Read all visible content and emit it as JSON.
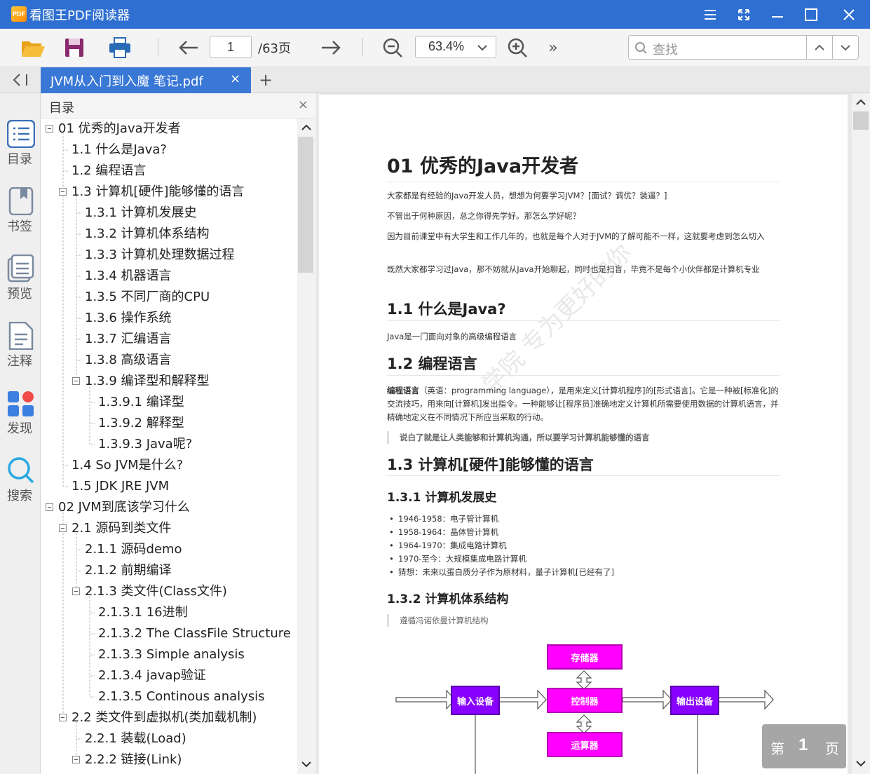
{
  "app": {
    "title": "看图王PDF阅读器",
    "logo_text": "PDF"
  },
  "toolbar": {
    "page_current": "1",
    "page_total": "/63页",
    "zoom": "63.4%",
    "more": "»",
    "search_placeholder": "查找"
  },
  "tabs": {
    "active_label": "JVM从入门到入魔 笔记.pdf",
    "close": "×",
    "add": "+"
  },
  "rail": [
    {
      "label": "目录",
      "icon": "toc-icon"
    },
    {
      "label": "书签",
      "icon": "bookmark-icon"
    },
    {
      "label": "预览",
      "icon": "preview-icon"
    },
    {
      "label": "注释",
      "icon": "annotation-icon"
    },
    {
      "label": "发现",
      "icon": "discover-icon"
    },
    {
      "label": "搜索",
      "icon": "search-icon"
    }
  ],
  "toc": {
    "title": "目录",
    "close": "×",
    "items": [
      {
        "text": "01 优秀的Java开发者",
        "level": 0,
        "expandable": true
      },
      {
        "text": "1.1 什么是Java?",
        "level": 1,
        "expandable": false
      },
      {
        "text": "1.2 编程语言",
        "level": 1,
        "expandable": false
      },
      {
        "text": "1.3 计算机[硬件]能够懂的语言",
        "level": 1,
        "expandable": true
      },
      {
        "text": "1.3.1 计算机发展史",
        "level": 2,
        "expandable": false
      },
      {
        "text": "1.3.2 计算机体系结构",
        "level": 2,
        "expandable": false
      },
      {
        "text": "1.3.3 计算机处理数据过程",
        "level": 2,
        "expandable": false
      },
      {
        "text": "1.3.4 机器语言",
        "level": 2,
        "expandable": false
      },
      {
        "text": "1.3.5 不同厂商的CPU",
        "level": 2,
        "expandable": false
      },
      {
        "text": "1.3.6 操作系统",
        "level": 2,
        "expandable": false
      },
      {
        "text": "1.3.7 汇编语言",
        "level": 2,
        "expandable": false
      },
      {
        "text": "1.3.8 高级语言",
        "level": 2,
        "expandable": false
      },
      {
        "text": "1.3.9 编译型和解释型",
        "level": 2,
        "expandable": true
      },
      {
        "text": "1.3.9.1 编译型",
        "level": 3,
        "expandable": false
      },
      {
        "text": "1.3.9.2 解释型",
        "level": 3,
        "expandable": false
      },
      {
        "text": "1.3.9.3 Java呢?",
        "level": 3,
        "expandable": false
      },
      {
        "text": "1.4 So JVM是什么?",
        "level": 1,
        "expandable": false
      },
      {
        "text": "1.5 JDK JRE JVM",
        "level": 1,
        "expandable": false
      },
      {
        "text": "02 JVM到底该学习什么",
        "level": 0,
        "expandable": true
      },
      {
        "text": "2.1 源码到类文件",
        "level": 1,
        "expandable": true
      },
      {
        "text": "2.1.1 源码demo",
        "level": 2,
        "expandable": false
      },
      {
        "text": "2.1.2 前期编译",
        "level": 2,
        "expandable": false
      },
      {
        "text": "2.1.3 类文件(Class文件)",
        "level": 2,
        "expandable": true
      },
      {
        "text": "2.1.3.1 16进制",
        "level": 3,
        "expandable": false
      },
      {
        "text": "2.1.3.2 The ClassFile Structure",
        "level": 3,
        "expandable": false
      },
      {
        "text": "2.1.3.3 Simple analysis",
        "level": 3,
        "expandable": false
      },
      {
        "text": "2.1.3.4 javap验证",
        "level": 3,
        "expandable": false
      },
      {
        "text": "2.1.3.5 Continous analysis",
        "level": 3,
        "expandable": false
      },
      {
        "text": "2.2 类文件到虚拟机(类加载机制)",
        "level": 1,
        "expandable": true
      },
      {
        "text": "2.2.1 装载(Load)",
        "level": 2,
        "expandable": false
      },
      {
        "text": "2.2.2 链接(Link)",
        "level": 2,
        "expandable": true
      }
    ]
  },
  "doc": {
    "h1": "01 优秀的Java开发者",
    "p1": "大家都是有经验的Java开发人员，想想为何要学习JVM？[面试？调优？装逼？]",
    "p2": "不管出于何种原因，总之你得先学好。那怎么学好呢？",
    "p3": "因为目前课堂中有大学生和工作几年的，也就是每个人对于JVM的了解可能不一样，这就要考虑到怎么切入",
    "p4": "既然大家都学习过Java，那不妨就从Java开始聊起，同时也是扫盲，毕竟不是每个小伙伴都是计算机专业",
    "h2_1": "1.1 什么是Java?",
    "p5": "Java是一门面向对象的高级编程语言",
    "h2_2": "1.2 编程语言",
    "p6_bold": "编程语言",
    "p6_rest": "（英语：programming language），是用来定义[计算机程序]的[形式语言]。它是一种被[标准化]的交流技巧，用来向[计算机]发出指令。一种能够让[程序员]准确地定义计算机所需要使用数据的计算机语言，并精确地定义在不同情况下所应当采取的行动。",
    "quote1": "说白了就是让人类能够和计算机沟通，所以要学习计算机能够懂的语言",
    "h2_3": "1.3 计算机[硬件]能够懂的语言",
    "h3_1": "1.3.1 计算机发展史",
    "bullets": [
      "1946-1958：电子管计算机",
      "1958-1964：晶体管计算机",
      "1964-1970：集成电路计算机",
      "1970-至今：大规模集成电路计算机",
      "猜想：未来以蛋白质分子作为原材料，量子计算机[已经有了]"
    ],
    "h3_2": "1.3.2 计算机体系结构",
    "quote2": "遵循冯诺依曼计算机结构",
    "watermark": "学院  专为更好的你",
    "diagram": {
      "memory": "存储器",
      "input": "输入设备",
      "control": "控制器",
      "output": "输出设备",
      "alu": "运算器"
    }
  },
  "page_indicator": {
    "prefix": "第",
    "num": "1",
    "suffix": "页"
  },
  "colors": {
    "titlebar": "#2f6fd1",
    "tab_active": "#3a78d6",
    "diagram_magenta": "#ff00ff",
    "diagram_purple": "#8800ff"
  }
}
